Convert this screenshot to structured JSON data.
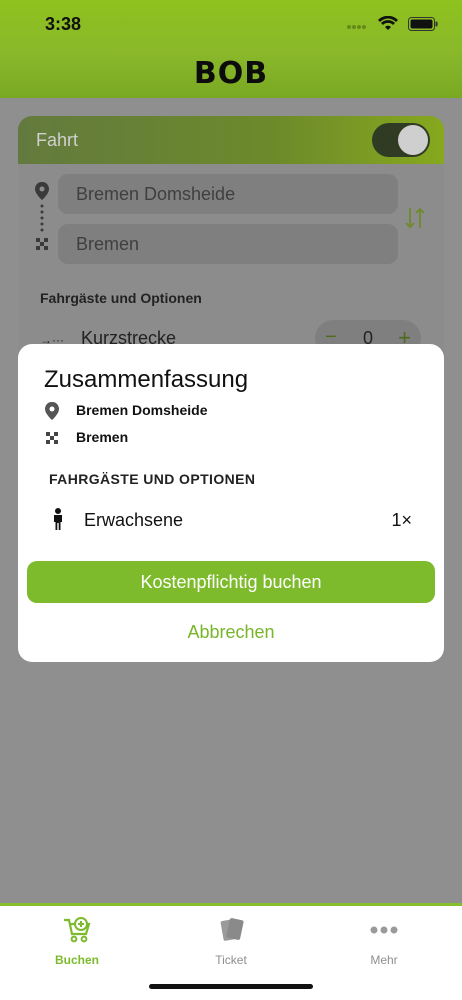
{
  "status_bar": {
    "time": "3:38"
  },
  "header": {
    "brand": "BOB"
  },
  "card": {
    "title": "Fahrt",
    "toggle_on": true,
    "from": "Bremen Domsheide",
    "to": "Bremen",
    "section_label": "Fahrgäste und Optionen",
    "option_label": "Kurzstrecke",
    "option_count": "0",
    "minus": "−",
    "plus": "+"
  },
  "modal": {
    "title": "Zusammenfassung",
    "from": "Bremen Domsheide",
    "to": "Bremen",
    "options_label": "FAHRGÄSTE UND OPTIONEN",
    "passenger_label": "Erwachsene",
    "passenger_count": "1×",
    "book_button": "Kostenpflichtig buchen",
    "cancel_button": "Abbrechen"
  },
  "tabbar": {
    "tabs": [
      {
        "label": "Buchen",
        "icon": "cart-add-icon",
        "active": true
      },
      {
        "label": "Ticket",
        "icon": "ticket-icon",
        "active": false
      },
      {
        "label": "Mehr",
        "icon": "more-icon",
        "active": false
      }
    ]
  },
  "colors": {
    "accent": "#7dbb2c",
    "header_green": "#8ec21e",
    "overlay": "#8f8f8f"
  }
}
